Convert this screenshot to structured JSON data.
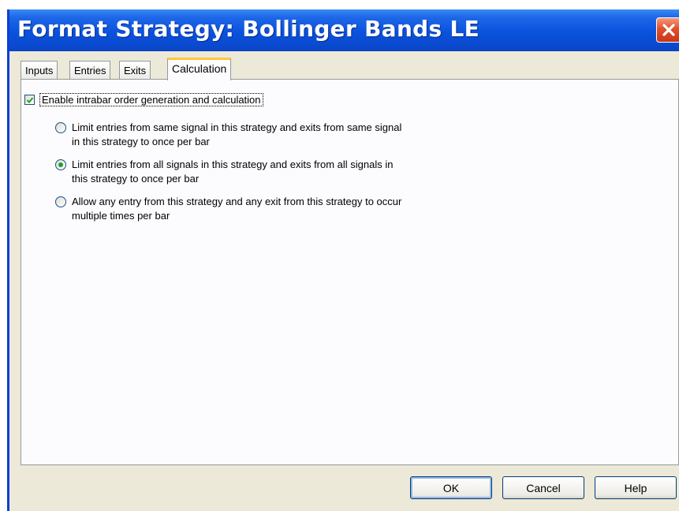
{
  "window": {
    "title": "Format Strategy: Bollinger Bands LE",
    "colors": {
      "titlebar": "#0a52dc",
      "close": "#e0502a",
      "active_tab_accent": "#ffc83c"
    }
  },
  "tabs": [
    {
      "label": "Inputs"
    },
    {
      "label": "Entries"
    },
    {
      "label": "Exits"
    },
    {
      "label": "Calculation",
      "active": true
    }
  ],
  "calculation": {
    "enable_intrabar": {
      "label": "Enable intrabar order generation and calculation",
      "checked": true
    },
    "options": [
      {
        "label": "Limit entries from same signal in this strategy and exits from same signal in this strategy to once per bar",
        "selected": false
      },
      {
        "label": "Limit entries from all signals in this strategy and exits from all signals in this strategy to once per bar",
        "selected": true
      },
      {
        "label": "Allow any entry from this strategy and any exit from this strategy to occur multiple times per bar",
        "selected": false
      }
    ]
  },
  "buttons": {
    "ok": "OK",
    "cancel": "Cancel",
    "help": "Help"
  },
  "icons": {
    "close": "close-icon",
    "check": "checkmark-icon"
  }
}
